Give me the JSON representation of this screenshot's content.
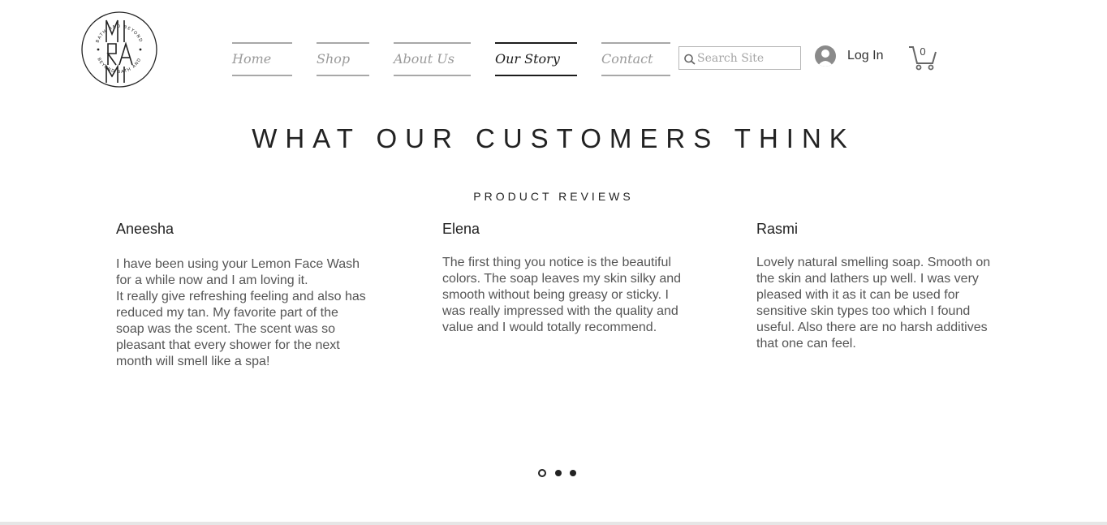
{
  "header": {
    "logo": {
      "top_text": "BATH AND BEYOND",
      "bottom_text": "BEYOND BATH AND",
      "monogram": "MIRAMI"
    },
    "nav": [
      {
        "label": "Home",
        "active": false
      },
      {
        "label": "Shop",
        "active": false
      },
      {
        "label": "About Us",
        "active": false
      },
      {
        "label": "Our Story",
        "active": true
      },
      {
        "label": "Contact",
        "active": false
      }
    ],
    "search": {
      "placeholder": "Search Site",
      "value": ""
    },
    "login_label": "Log In",
    "cart_count": "0"
  },
  "main": {
    "heading": "WHAT OUR CUSTOMERS THINK",
    "subheading": "PRODUCT REVIEWS",
    "reviews": [
      {
        "name": "Aneesha",
        "text": "I have been using your Lemon Face Wash for a while now and I am loving it.\nIt really give refreshing feeling and also has reduced my tan. My favorite part of the soap was the scent. The scent was so pleasant that every shower for the next month will smell like a spa!"
      },
      {
        "name": "Elena",
        "text": "The first thing you notice is the beautiful colors. The soap leaves my skin silky and smooth without being greasy or sticky. I was really impressed with the quality and value and I would totally recommend."
      },
      {
        "name": "Rasmi",
        "text": "Lovely natural smelling soap. Smooth on the skin and lathers up well. I was very pleased with it as it can be used for sensitive skin types too which I found useful. Also there are no harsh additives that one can feel."
      }
    ],
    "slider": {
      "count": 3,
      "active_index": 0
    }
  },
  "colors": {
    "text": "#222222",
    "muted": "#9a9a9a",
    "body_text": "#555555",
    "nav_line": "#a8a8a8",
    "nav_active": "#1c1c1c"
  }
}
